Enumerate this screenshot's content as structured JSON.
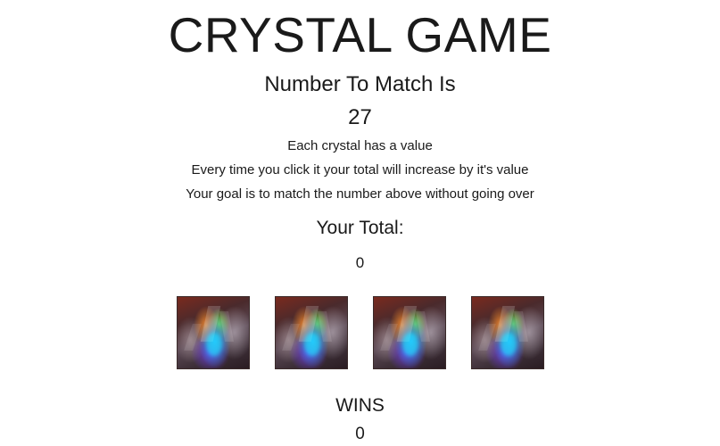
{
  "title": "CRYSTAL GAME",
  "match": {
    "heading": "Number To Match Is",
    "value": "27"
  },
  "instructions": [
    "Each crystal has a value",
    "Every time you click it your total will increase by it's value",
    "Your goal is to match the number above without going over"
  ],
  "total": {
    "heading": "Your Total:",
    "value": "0"
  },
  "crystals": [
    {
      "icon": "crystal-image"
    },
    {
      "icon": "crystal-image"
    },
    {
      "icon": "crystal-image"
    },
    {
      "icon": "crystal-image"
    }
  ],
  "wins": {
    "label": "WINS",
    "value": "0"
  }
}
